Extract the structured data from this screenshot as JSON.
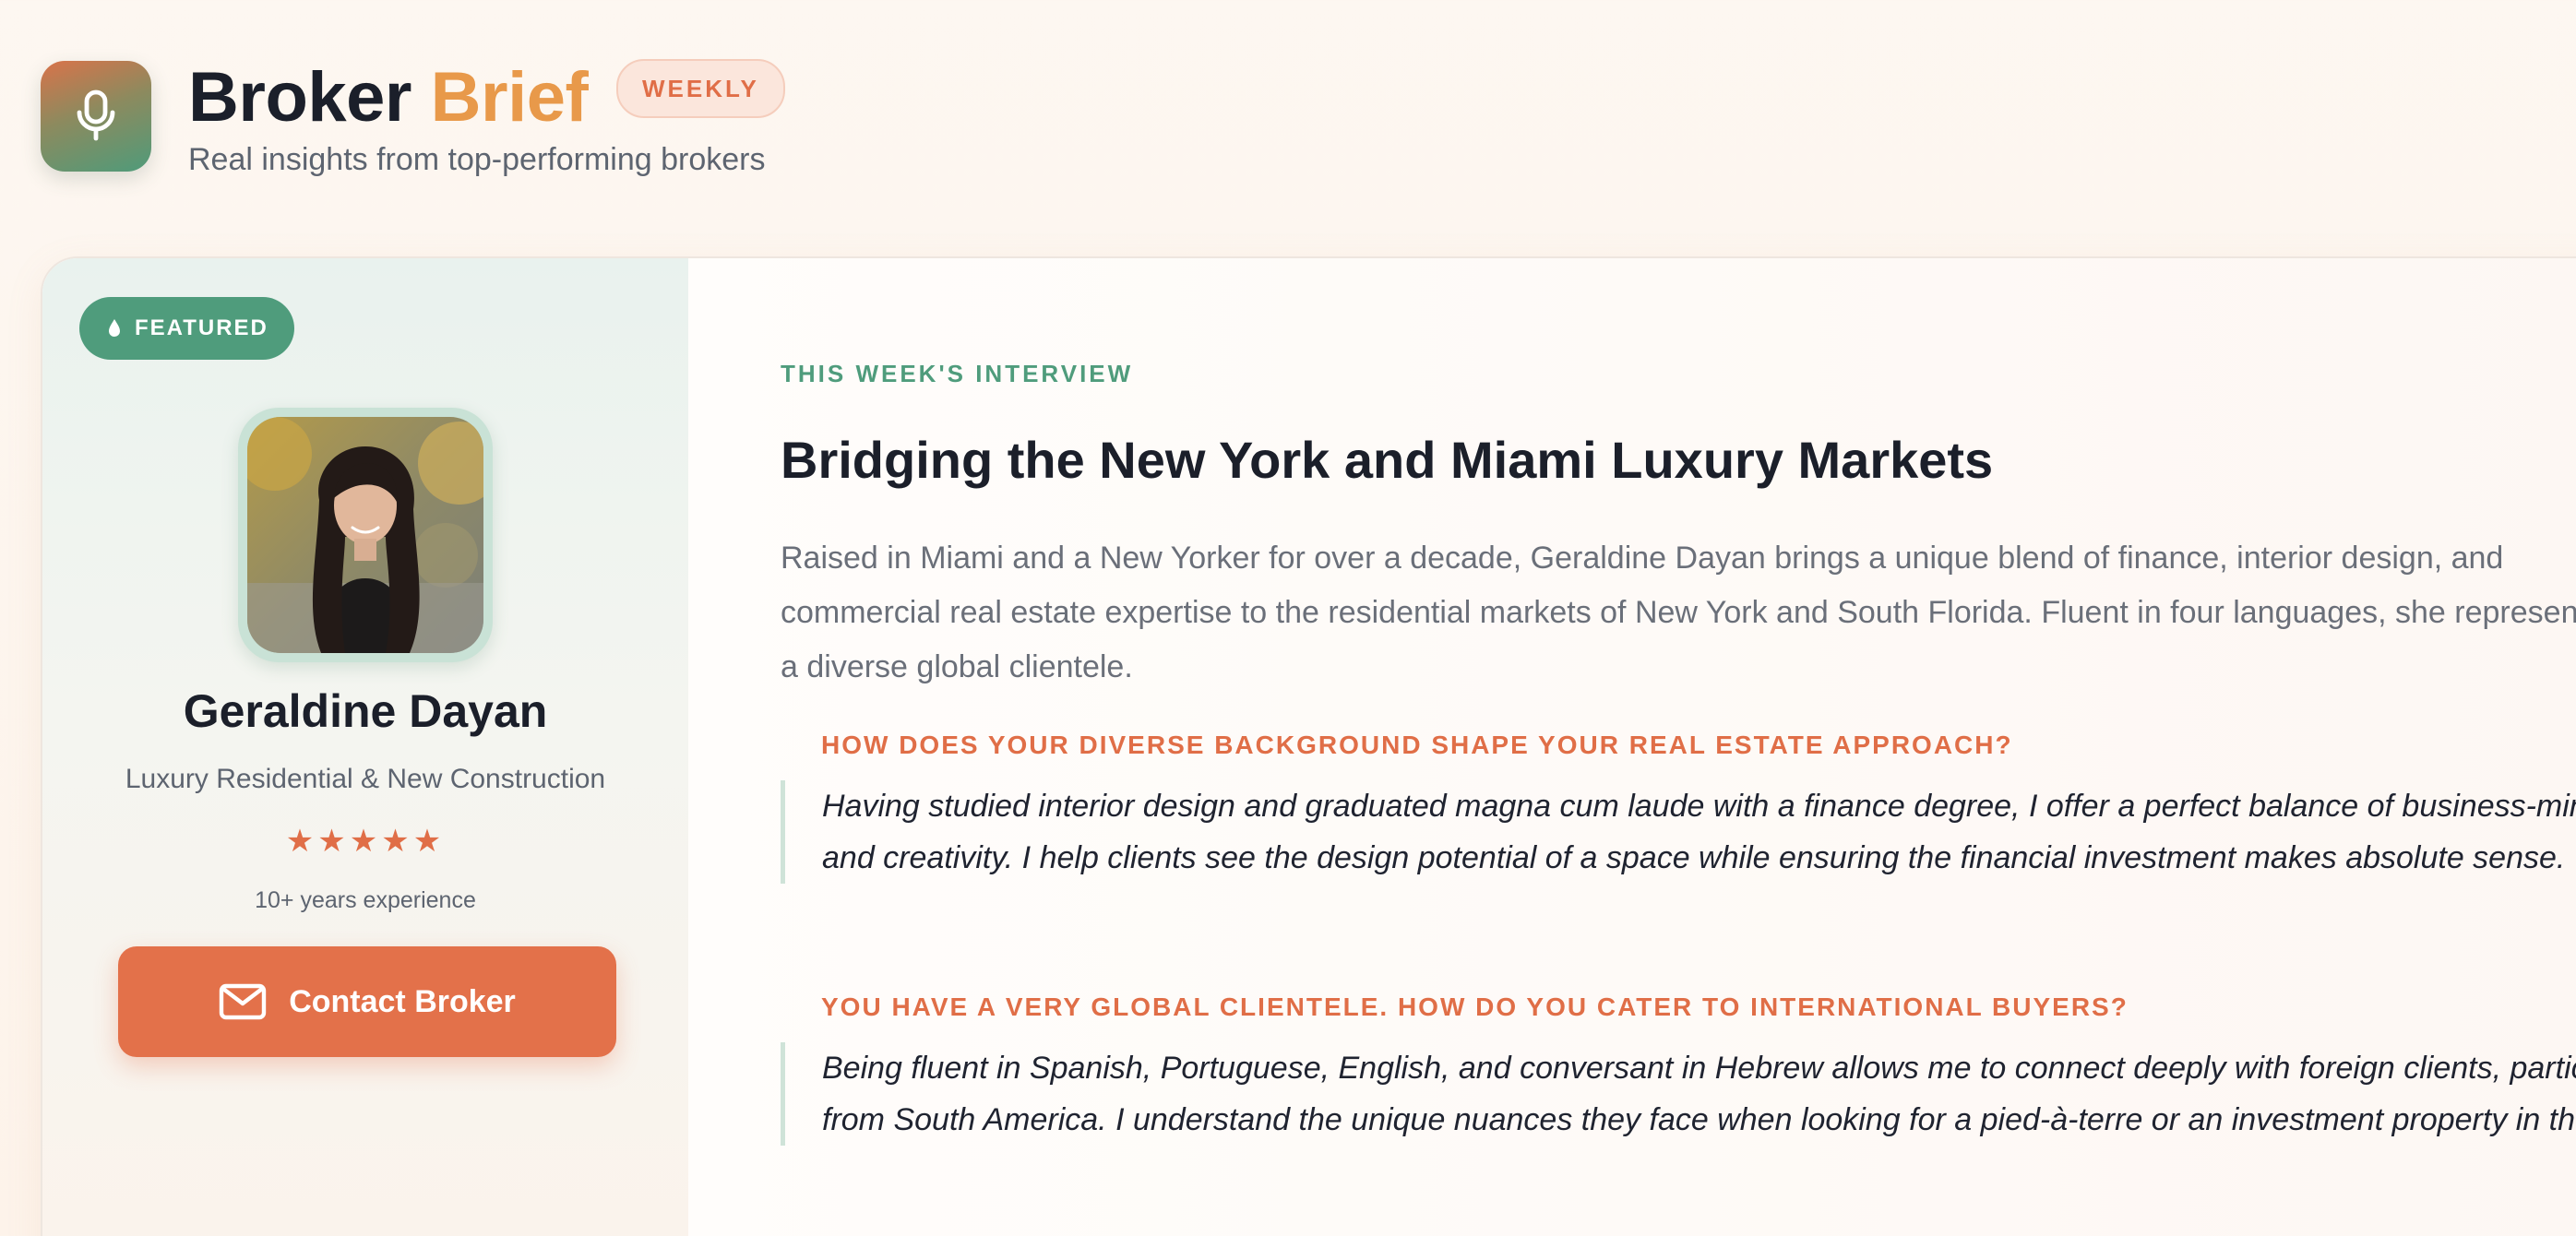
{
  "header": {
    "brand_part1": "Broker",
    "brand_part2": "Brief",
    "badge": "WEEKLY",
    "tagline": "Real insights from top-performing brokers",
    "logo_icon": "microphone-icon"
  },
  "profile": {
    "featured_label": "FEATURED",
    "featured_icon": "droplet-icon",
    "name": "Geraldine Dayan",
    "specialty": "Luxury Residential & New Construction",
    "rating": 5,
    "stars": "★★★★★",
    "experience": "10+ years experience",
    "contact_label": "Contact Broker",
    "contact_icon": "mail-icon"
  },
  "interview": {
    "eyebrow": "THIS WEEK'S INTERVIEW",
    "title": "Bridging the New York and Miami Luxury Markets",
    "intro": "Raised in Miami and a New Yorker for over a decade, Geraldine Dayan brings a unique blend of finance, interior design, and commercial real estate expertise to the residential markets of New York and South Florida. Fluent in four languages, she represents a diverse global clientele.",
    "qa": [
      {
        "question": "HOW DOES YOUR DIVERSE BACKGROUND SHAPE YOUR REAL ESTATE APPROACH?",
        "answer": "Having studied interior design and graduated magna cum laude with a finance degree, I offer a perfect balance of business-mindedness and creativity. I help clients see the design potential of a space while ensuring the financial investment makes absolute sense."
      },
      {
        "question": "YOU HAVE A VERY GLOBAL CLIENTELE. HOW DO YOU CATER TO INTERNATIONAL BUYERS?",
        "answer": "Being fluent in Spanish, Portuguese, English, and conversant in Hebrew allows me to connect deeply with foreign clients, particularly from South America. I understand the unique nuances they face when looking for a pied-à-terre or an investment property in the US."
      }
    ]
  },
  "colors": {
    "accent_orange": "#e3714a",
    "accent_gold": "#e8994a",
    "accent_green": "#4f9c7c",
    "text_dark": "#1b1f2a",
    "text_muted": "#5d6470"
  }
}
